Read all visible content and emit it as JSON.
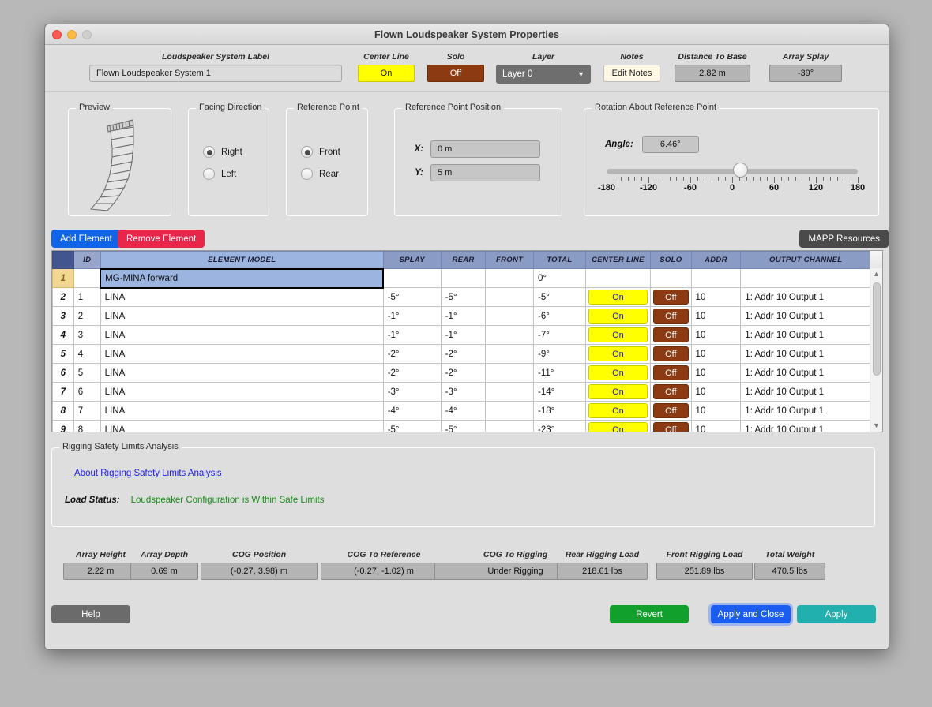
{
  "window": {
    "title": "Flown Loudspeaker System Properties",
    "controls": [
      "close",
      "minimize",
      "zoom"
    ]
  },
  "top": {
    "label_caption": "Loudspeaker System Label",
    "label_value": "Flown Loudspeaker System 1",
    "center_line_caption": "Center Line",
    "center_line_value": "On",
    "solo_caption": "Solo",
    "solo_value": "Off",
    "layer_caption": "Layer",
    "layer_value": "Layer 0",
    "notes_caption": "Notes",
    "notes_button": "Edit Notes",
    "distance_caption": "Distance To Base",
    "distance_value": "2.82 m",
    "splay_caption": "Array Splay",
    "splay_value": "-39°"
  },
  "preview": {
    "title": "Preview"
  },
  "facing": {
    "title": "Facing Direction",
    "options": [
      {
        "label": "Right",
        "selected": true
      },
      {
        "label": "Left",
        "selected": false
      }
    ]
  },
  "reference_point": {
    "title": "Reference Point",
    "options": [
      {
        "label": "Front",
        "selected": true
      },
      {
        "label": "Rear",
        "selected": false
      }
    ]
  },
  "reference_position": {
    "title": "Reference Point Position",
    "x_label": "X:",
    "x_value": "0 m",
    "y_label": "Y:",
    "y_value": "5 m"
  },
  "rotation": {
    "title": "Rotation About Reference Point",
    "angle_label": "Angle:",
    "angle_value": "6.46°",
    "slider_min": -180,
    "slider_max": 180,
    "slider_value": 6.46,
    "tick_labels": [
      "-180",
      "-120",
      "-60",
      "0",
      "60",
      "120",
      "180"
    ]
  },
  "toolbar": {
    "add_element": "Add Element",
    "remove_element": "Remove Element",
    "mapp_resources": "MAPP Resources",
    "add_color": "#1064e8",
    "remove_color": "#e8264a",
    "mapp_color": "#4a4a4a"
  },
  "table": {
    "columns": [
      "",
      "ID",
      "ELEMENT MODEL",
      "SPLAY",
      "REAR",
      "FRONT",
      "TOTAL",
      "CENTER LINE",
      "SOLO",
      "ADDR",
      "OUTPUT CHANNEL"
    ],
    "rows": [
      {
        "n": "1",
        "id": "",
        "model": "MG-MINA forward",
        "splay": "",
        "rear": "",
        "front": "",
        "total": "0°",
        "center_line": "",
        "solo": "",
        "addr": "",
        "output": "",
        "selected": true
      },
      {
        "n": "2",
        "id": "1",
        "model": "LINA",
        "splay": "-5°",
        "rear": "-5°",
        "front": "",
        "total": "-5°",
        "center_line": "On",
        "solo": "Off",
        "addr": "10",
        "output": "1: Addr 10 Output 1",
        "selected": false
      },
      {
        "n": "3",
        "id": "2",
        "model": "LINA",
        "splay": "-1°",
        "rear": "-1°",
        "front": "",
        "total": "-6°",
        "center_line": "On",
        "solo": "Off",
        "addr": "10",
        "output": "1: Addr 10 Output 1",
        "selected": false
      },
      {
        "n": "4",
        "id": "3",
        "model": "LINA",
        "splay": "-1°",
        "rear": "-1°",
        "front": "",
        "total": "-7°",
        "center_line": "On",
        "solo": "Off",
        "addr": "10",
        "output": "1: Addr 10 Output 1",
        "selected": false
      },
      {
        "n": "5",
        "id": "4",
        "model": "LINA",
        "splay": "-2°",
        "rear": "-2°",
        "front": "",
        "total": "-9°",
        "center_line": "On",
        "solo": "Off",
        "addr": "10",
        "output": "1: Addr 10 Output 1",
        "selected": false
      },
      {
        "n": "6",
        "id": "5",
        "model": "LINA",
        "splay": "-2°",
        "rear": "-2°",
        "front": "",
        "total": "-11°",
        "center_line": "On",
        "solo": "Off",
        "addr": "10",
        "output": "1: Addr 10 Output 1",
        "selected": false
      },
      {
        "n": "7",
        "id": "6",
        "model": "LINA",
        "splay": "-3°",
        "rear": "-3°",
        "front": "",
        "total": "-14°",
        "center_line": "On",
        "solo": "Off",
        "addr": "10",
        "output": "1: Addr 10 Output 1",
        "selected": false
      },
      {
        "n": "8",
        "id": "7",
        "model": "LINA",
        "splay": "-4°",
        "rear": "-4°",
        "front": "",
        "total": "-18°",
        "center_line": "On",
        "solo": "Off",
        "addr": "10",
        "output": "1: Addr 10 Output 1",
        "selected": false
      },
      {
        "n": "9",
        "id": "8",
        "model": "LINA",
        "splay": "-5°",
        "rear": "-5°",
        "front": "",
        "total": "-23°",
        "center_line": "On",
        "solo": "Off",
        "addr": "10",
        "output": "1: Addr 10 Output 1",
        "selected": false
      }
    ]
  },
  "rigging": {
    "title": "Rigging Safety Limits Analysis",
    "link": "About Rigging Safety Limits Analysis",
    "status_label": "Load Status:",
    "status_value": "Loudspeaker Configuration is Within Safe Limits",
    "status_color": "#1a8a1a"
  },
  "summary": [
    {
      "label": "Array Height",
      "value": "2.22 m"
    },
    {
      "label": "Array Depth",
      "value": "0.69 m"
    },
    {
      "label": "COG Position",
      "value": "(-0.27, 3.98)  m"
    },
    {
      "label": "COG To Reference",
      "value": "(-0.27, -1.02)  m"
    },
    {
      "label": "COG To Rigging",
      "value": "Under Rigging"
    },
    {
      "label": "Rear Rigging Load",
      "value": "218.61 lbs"
    },
    {
      "label": "Front Rigging Load",
      "value": "251.89 lbs"
    },
    {
      "label": "Total Weight",
      "value": "470.5 lbs"
    }
  ],
  "footer": {
    "help": "Help",
    "revert": "Revert",
    "apply_and_close": "Apply and Close",
    "apply": "Apply",
    "help_color": "#6b6b6b",
    "revert_color": "#11a02c",
    "apply_close_color": "#1a5df0",
    "apply_color": "#21b0ae"
  }
}
